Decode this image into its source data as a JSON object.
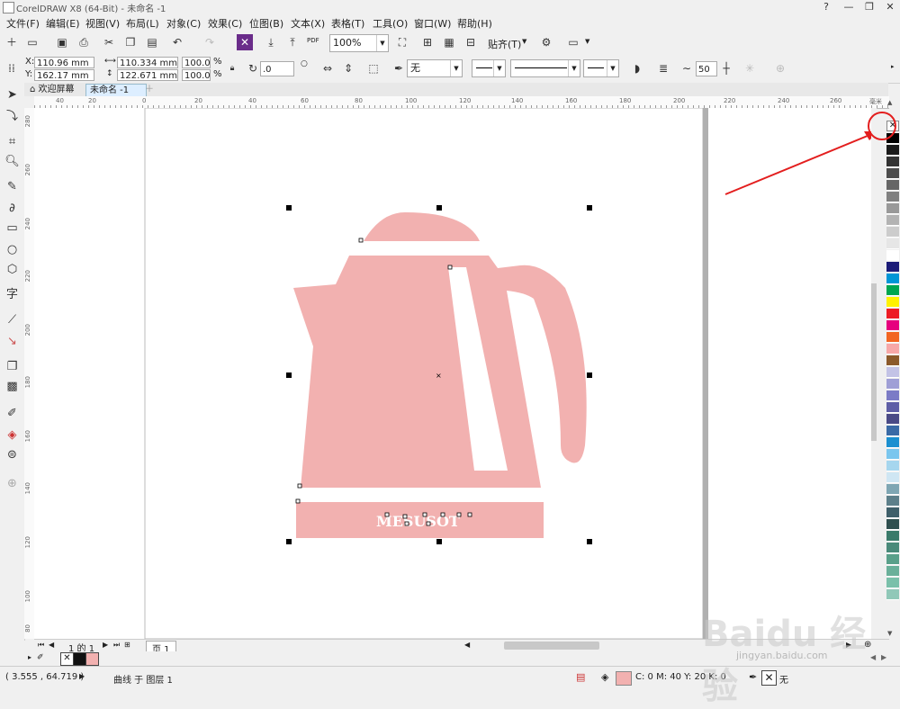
{
  "window": {
    "title": "CorelDRAW X8 (64-Bit) - 未命名 -1",
    "controls": [
      "?",
      "—",
      "❐",
      "✕"
    ]
  },
  "menu": [
    "文件(F)",
    "编辑(E)",
    "视图(V)",
    "布局(L)",
    "对象(C)",
    "效果(C)",
    "位图(B)",
    "文本(X)",
    "表格(T)",
    "工具(O)",
    "窗口(W)",
    "帮助(H)"
  ],
  "toolbar": {
    "zoom": "100%",
    "snap_label": "贴齐(T)",
    "pdf_label": "PDF"
  },
  "properties": {
    "x_label": "X:",
    "x": "110.96 mm",
    "y_label": "Y:",
    "y": "162.17 mm",
    "w": "110.334 mm",
    "h": "122.671 mm",
    "scale_w": "100.0",
    "scale_h": "100.0",
    "pct": "%",
    "rotation": ".0",
    "fill_none": "无",
    "smooth": "50"
  },
  "tabs": [
    {
      "label": "欢迎屏幕"
    },
    {
      "label": "未命名 -1"
    }
  ],
  "ruler": {
    "h_labels": [
      "40",
      "20",
      "0",
      "20",
      "40",
      "60",
      "80",
      "100",
      "120",
      "140",
      "160",
      "180",
      "200",
      "220",
      "240",
      "260"
    ],
    "unit": "毫米",
    "v_labels": [
      "280",
      "260",
      "240",
      "220",
      "200",
      "180",
      "160",
      "140",
      "120",
      "100",
      "80"
    ]
  },
  "drawing": {
    "kettle_color": "#f2b1b0",
    "label_text": "MESUSOT"
  },
  "pagenav": {
    "page_counter": "1 的 1",
    "page_tab": "页 1"
  },
  "status": {
    "coords": "( 3.555 , 64.719 )",
    "object_info": "曲线 于 图层 1",
    "fill_info": "C: 0 M: 40 Y: 20 K: 0",
    "outline_info": "无",
    "fill_color": "#f2b1b0"
  },
  "palette": [
    "#000000",
    "#1a1a1a",
    "#333333",
    "#4d4d4d",
    "#666666",
    "#808080",
    "#999999",
    "#b3b3b3",
    "#cccccc",
    "#e6e6e6",
    "#ffffff",
    "#1c1c78",
    "#0096d6",
    "#00a650",
    "#fff200",
    "#ed1c24",
    "#e6007e",
    "#f26522",
    "#f7a8a8",
    "#8b5a2b",
    "#c3c3e6",
    "#9f9fd6",
    "#7b7bc6",
    "#5e5ea6",
    "#4a4a86",
    "#3a6aa6",
    "#1b8fd0",
    "#7ac6ee",
    "#a6d6ee",
    "#cfe6f3",
    "#7fa6b3",
    "#5d7f8a",
    "#3f5f6a",
    "#2f4f4f",
    "#3a7a6a",
    "#4a8a7a",
    "#5aa08a",
    "#6ab09a",
    "#7ac0aa",
    "#90c8b8"
  ],
  "watermark": {
    "brand": "Baidu 经验",
    "url": "jingyan.baidu.com"
  }
}
